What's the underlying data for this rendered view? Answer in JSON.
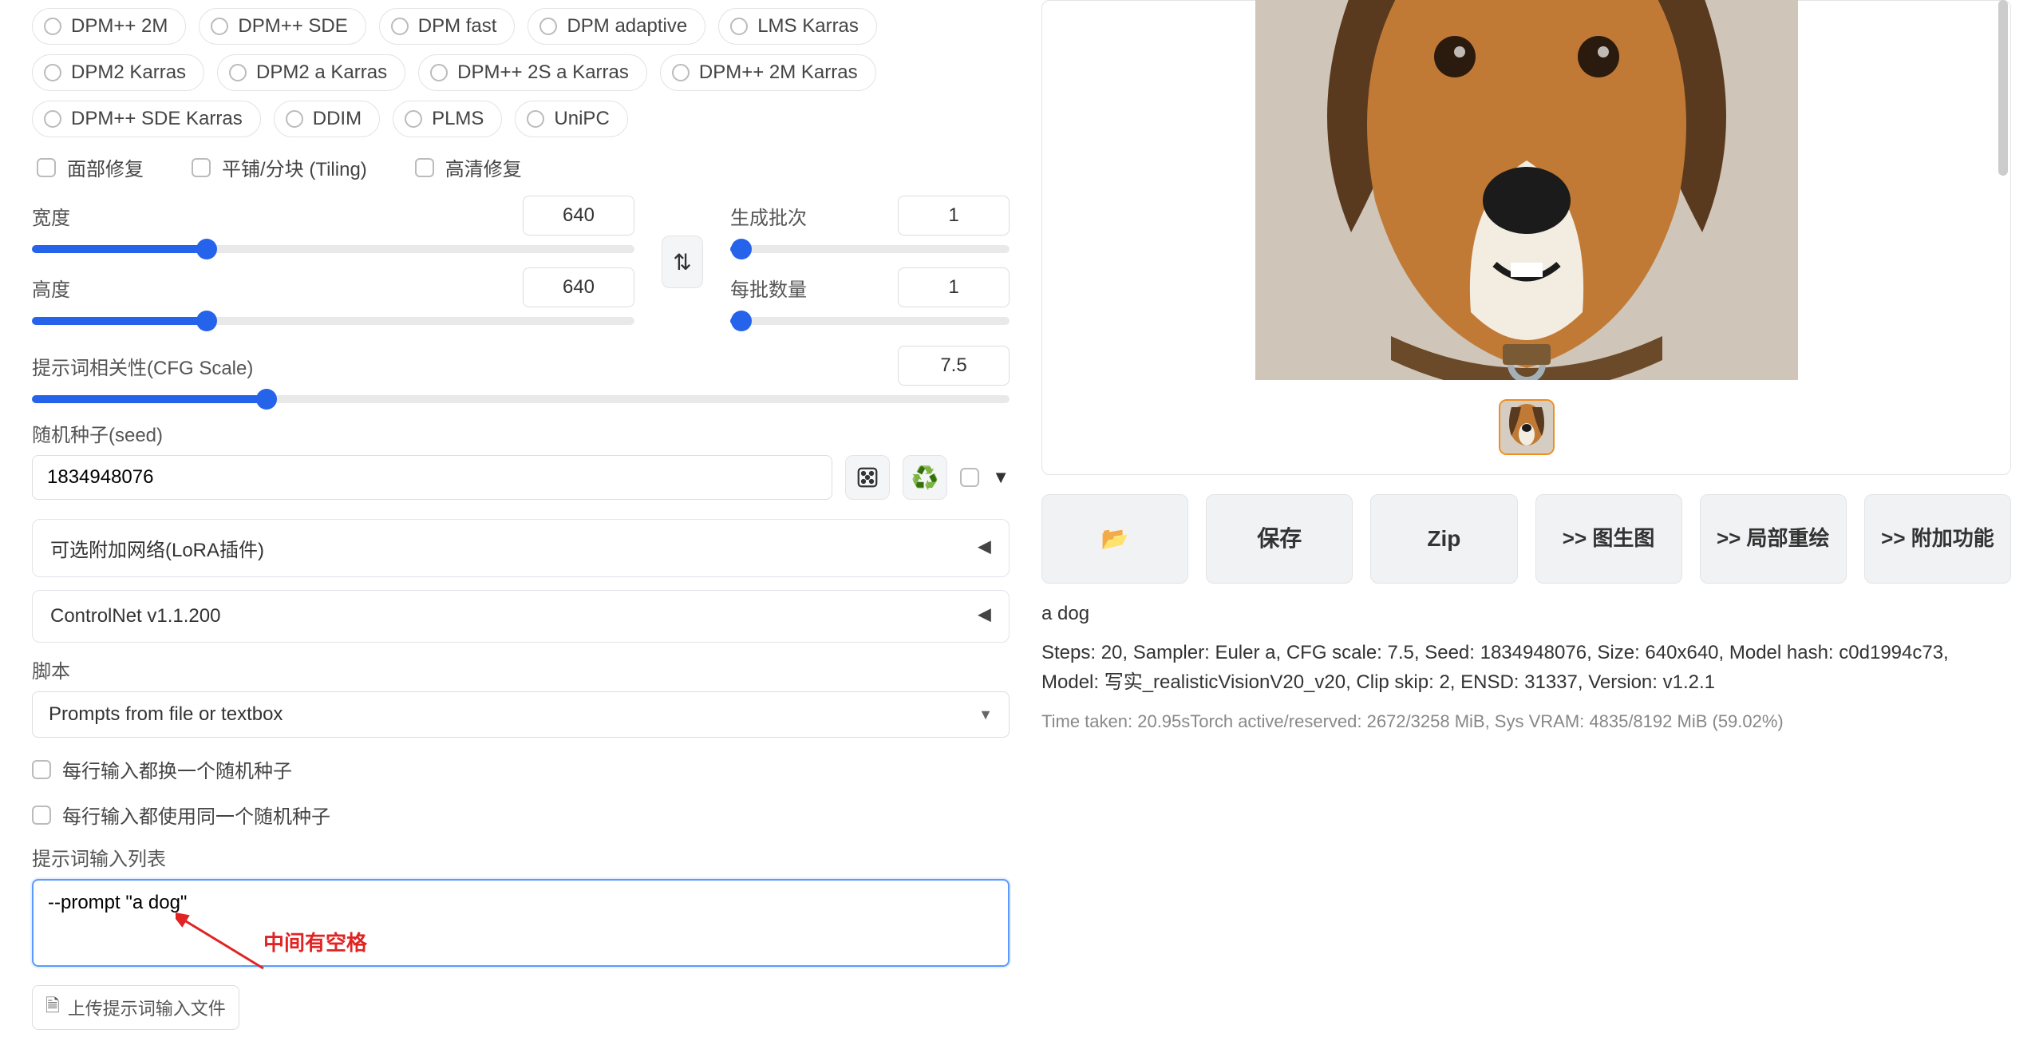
{
  "samplers_row1": [
    "DPM++ 2M",
    "DPM++ SDE",
    "DPM fast",
    "DPM adaptive",
    "LMS Karras"
  ],
  "samplers_row2": [
    "DPM2 Karras",
    "DPM2 a Karras",
    "DPM++ 2S a Karras",
    "DPM++ 2M Karras"
  ],
  "samplers_row3": [
    "DPM++ SDE Karras",
    "DDIM",
    "PLMS",
    "UniPC"
  ],
  "checks": {
    "face_restore": "面部修复",
    "tiling": "平铺/分块 (Tiling)",
    "hires": "高清修复"
  },
  "labels": {
    "width": "宽度",
    "height": "高度",
    "batch_count": "生成批次",
    "batch_size": "每批数量",
    "cfg": "提示词相关性(CFG Scale)",
    "seed": "随机种子(seed)",
    "lora": "可选附加网络(LoRA插件)",
    "controlnet": "ControlNet v1.1.200",
    "script": "脚本",
    "script_selected": "Prompts from file or textbox",
    "iter_seed": "每行输入都换一个随机种子",
    "same_seed": "每行输入都使用同一个随机种子",
    "prompt_list": "提示词输入列表",
    "upload": "上传提示词输入文件"
  },
  "values": {
    "width": "640",
    "height": "640",
    "batch_count": "1",
    "batch_size": "1",
    "cfg": "7.5",
    "seed": "1834948076",
    "prompt_list_text": "--prompt \"a dog\""
  },
  "slider_fill": {
    "width": 29,
    "height": 29,
    "batch_count": 4,
    "batch_size": 4,
    "cfg": 24
  },
  "annotation": "中间有空格",
  "actions": {
    "folder_icon": "📂",
    "save": "保存",
    "zip": "Zip",
    "img2img": ">> 图生图",
    "inpaint": ">> 局部重绘",
    "extras": ">> 附加功能"
  },
  "result": {
    "prompt": "a dog",
    "params": "Steps: 20, Sampler: Euler a, CFG scale: 7.5, Seed: 1834948076, Size: 640x640, Model hash: c0d1994c73, Model: 写实_realisticVisionV20_v20, Clip skip: 2, ENSD: 31337, Version: v1.2.1",
    "time": "Time taken: 20.95sTorch active/reserved: 2672/3258 MiB, Sys VRAM: 4835/8192 MiB (59.02%)"
  }
}
